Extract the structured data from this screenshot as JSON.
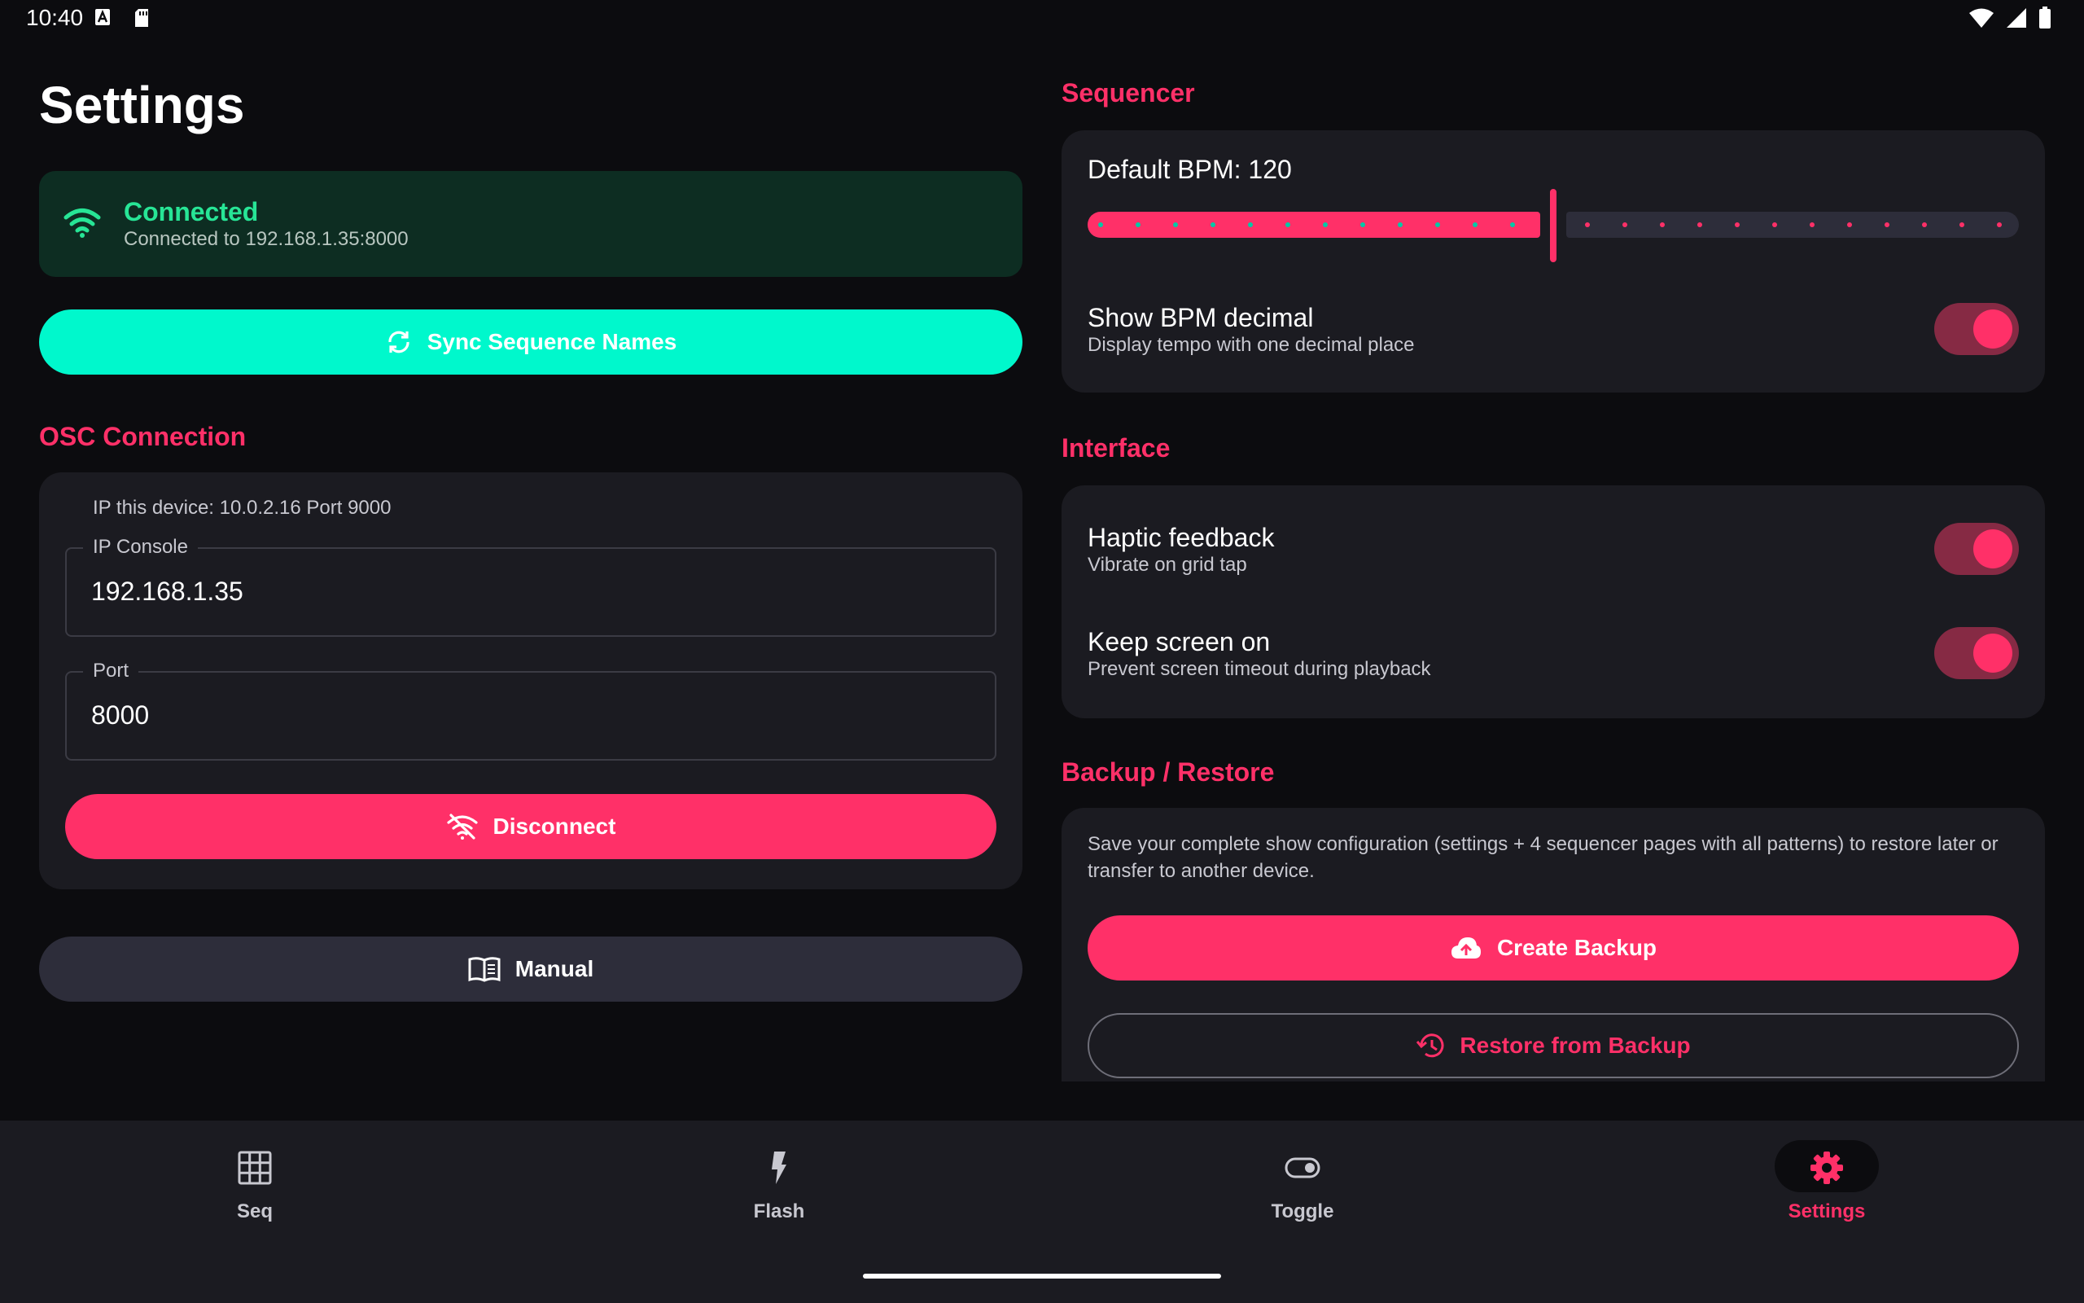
{
  "status_bar": {
    "time": "10:40"
  },
  "page": {
    "title": "Settings"
  },
  "connection_status": {
    "title": "Connected",
    "subtitle": "Connected to 192.168.1.35:8000"
  },
  "sync_button": {
    "label": "Sync Sequence Names"
  },
  "osc": {
    "section_label": "OSC Connection",
    "device_info": "IP this device: 10.0.2.16  Port 9000",
    "ip_console": {
      "label": "IP Console",
      "value": "192.168.1.35"
    },
    "port": {
      "label": "Port",
      "value": "8000"
    },
    "disconnect_label": "Disconnect"
  },
  "manual_button": {
    "label": "Manual"
  },
  "sequencer": {
    "section_label": "Sequencer",
    "bpm_label": "Default BPM: 120",
    "bpm_slider_fraction": 0.5,
    "show_decimal": {
      "title": "Show BPM decimal",
      "subtitle": "Display tempo with one decimal place",
      "enabled": true
    }
  },
  "interface": {
    "section_label": "Interface",
    "haptic": {
      "title": "Haptic feedback",
      "subtitle": "Vibrate on grid tap",
      "enabled": true
    },
    "keep_screen": {
      "title": "Keep screen on",
      "subtitle": "Prevent screen timeout during playback",
      "enabled": true
    }
  },
  "backup": {
    "section_label": "Backup / Restore",
    "description": "Save your complete show configuration (settings + 4 sequencer pages with all patterns) to restore later or transfer to another device.",
    "create_label": "Create Backup",
    "restore_label": "Restore from Backup"
  },
  "bottom_nav": {
    "items": [
      {
        "label": "Seq",
        "icon": "grid-icon",
        "active": false
      },
      {
        "label": "Flash",
        "icon": "flash-icon",
        "active": false
      },
      {
        "label": "Toggle",
        "icon": "toggle-icon",
        "active": false
      },
      {
        "label": "Settings",
        "icon": "gear-icon",
        "active": true
      }
    ]
  },
  "colors": {
    "accent": "#ff3068",
    "connected_green": "#27e596",
    "sync_cyan": "#00f8cc",
    "background": "#0c0c0f",
    "card": "#1b1b21"
  }
}
